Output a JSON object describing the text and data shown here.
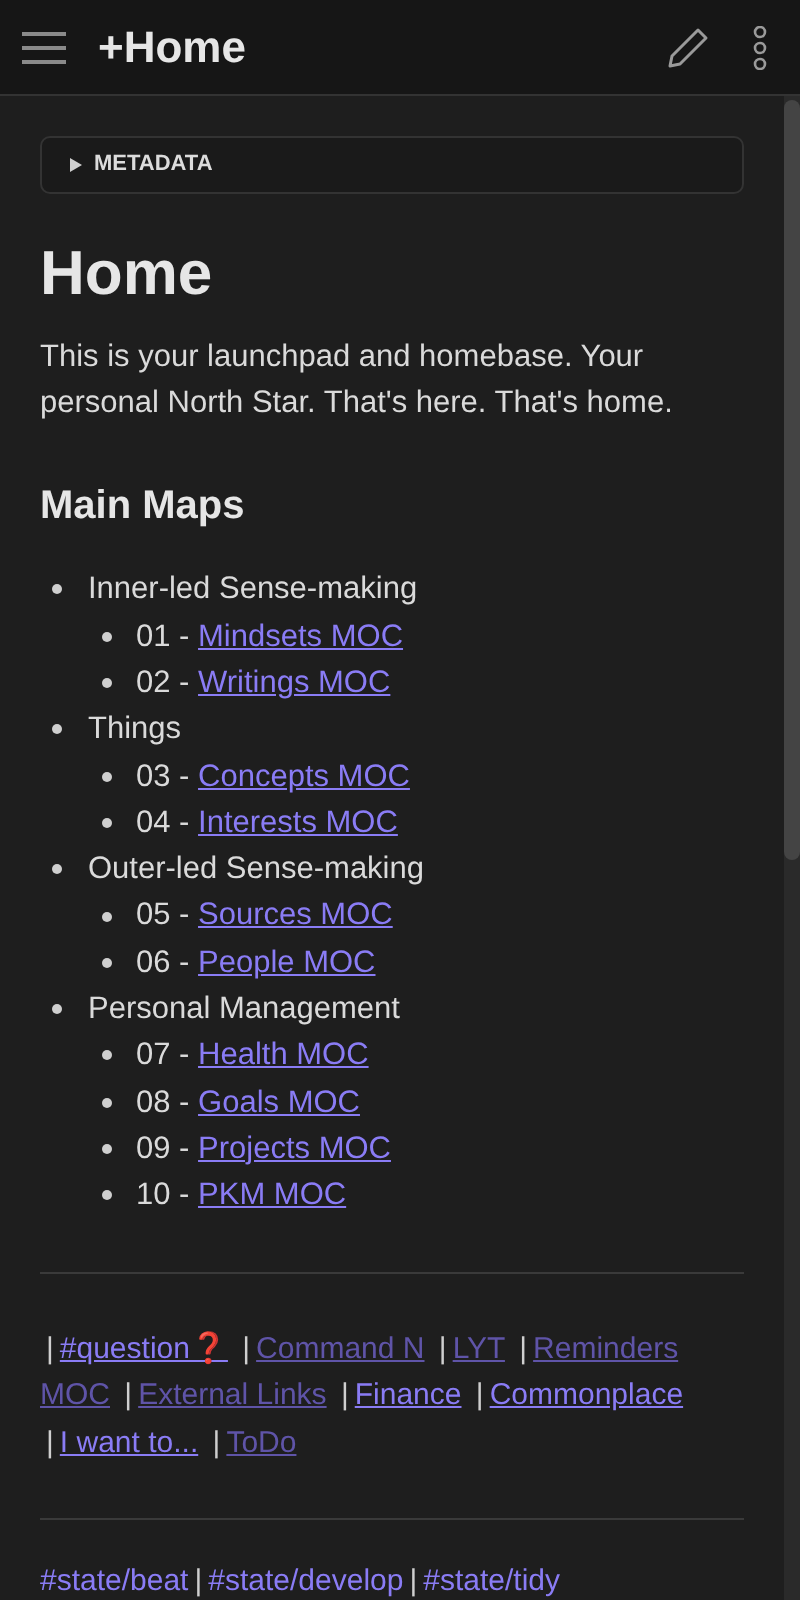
{
  "header": {
    "title": "+Home"
  },
  "metadata": {
    "label": "METADATA",
    "expanded": false
  },
  "title": "Home",
  "intro": "This is your launchpad and homebase. Your personal North Star. That's here. That's home.",
  "section": "Main Maps",
  "maps": [
    {
      "label": "Inner-led Sense-making",
      "children": [
        {
          "prefix": "01 - ",
          "link": "Mindsets MOC"
        },
        {
          "prefix": "02 - ",
          "link": "Writings MOC"
        }
      ]
    },
    {
      "label": "Things",
      "children": [
        {
          "prefix": "03 - ",
          "link": "Concepts MOC"
        },
        {
          "prefix": "04 - ",
          "link": "Interests MOC"
        }
      ]
    },
    {
      "label": "Outer-led Sense-making",
      "children": [
        {
          "prefix": "05 - ",
          "link": "Sources MOC"
        },
        {
          "prefix": "06 - ",
          "link": "People MOC"
        }
      ]
    },
    {
      "label": "Personal Management",
      "children": [
        {
          "prefix": "07 - ",
          "link": "Health MOC"
        },
        {
          "prefix": "08 - ",
          "link": "Goals MOC"
        },
        {
          "prefix": "09 - ",
          "link": "Projects MOC"
        },
        {
          "prefix": "10 - ",
          "link": "PKM MOC"
        }
      ]
    }
  ],
  "separator": "|",
  "quick_links": [
    {
      "parts": [
        "#question❓"
      ],
      "resolved": true
    },
    {
      "parts": [
        "Command N"
      ],
      "resolved": false
    },
    {
      "parts": [
        "LYT"
      ],
      "resolved": false
    },
    {
      "parts": [
        "Reminders",
        "MOC"
      ],
      "resolved": false
    },
    {
      "parts": [
        "External Links"
      ],
      "resolved": false
    },
    {
      "parts": [
        "Finance"
      ],
      "resolved": true
    },
    {
      "parts": [
        "Commonplace"
      ],
      "resolved": true
    },
    {
      "parts": [
        "I want to..."
      ],
      "resolved": true
    },
    {
      "parts": [
        "ToDo"
      ],
      "resolved": false
    }
  ],
  "state_tags": [
    "#state/beat",
    "#state/develop",
    "#state/tidy"
  ]
}
